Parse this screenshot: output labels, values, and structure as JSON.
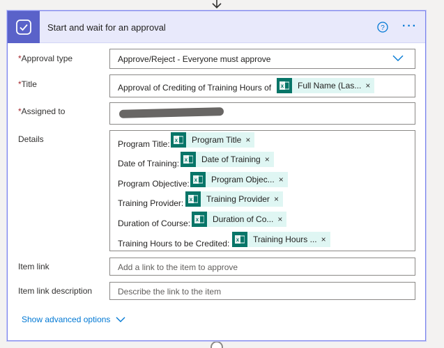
{
  "card": {
    "title": "Start and wait for an approval",
    "help_icon": "help-circle-icon",
    "more_icon": "more-ellipsis-icon",
    "more_label": "···"
  },
  "fields": {
    "approval_type": {
      "label": "Approval type",
      "required": "*",
      "value": "Approve/Reject - Everyone must approve"
    },
    "title": {
      "label": "Title",
      "required": "*",
      "prefix": "Approval of Crediting of Training Hours of",
      "token": "Full Name (Las..."
    },
    "assigned_to": {
      "label": "Assigned to",
      "required": "*"
    },
    "details": {
      "label": "Details",
      "lines": [
        {
          "text": "Program Title:",
          "token": "Program Title"
        },
        {
          "text": "Date of Training:",
          "token": "Date of Training"
        },
        {
          "text": "Program Objective:",
          "token": "Program Objec..."
        },
        {
          "text": "Training Provider:",
          "token": "Training Provider"
        },
        {
          "text": "Duration of Course:",
          "token": "Duration of Co..."
        },
        {
          "text": "Training Hours to be Credited:",
          "token": "Training Hours ..."
        }
      ]
    },
    "item_link": {
      "label": "Item link",
      "placeholder": "Add a link to the item to approve"
    },
    "item_link_description": {
      "label": "Item link description",
      "placeholder": "Describe the link to the item"
    }
  },
  "show_advanced": "Show advanced options",
  "token_close": "×",
  "colors": {
    "accent": "#5a62c9",
    "token_icon": "#077568",
    "token_bg": "#dff6f3",
    "link": "#0078d4",
    "required": "#a4262c"
  }
}
